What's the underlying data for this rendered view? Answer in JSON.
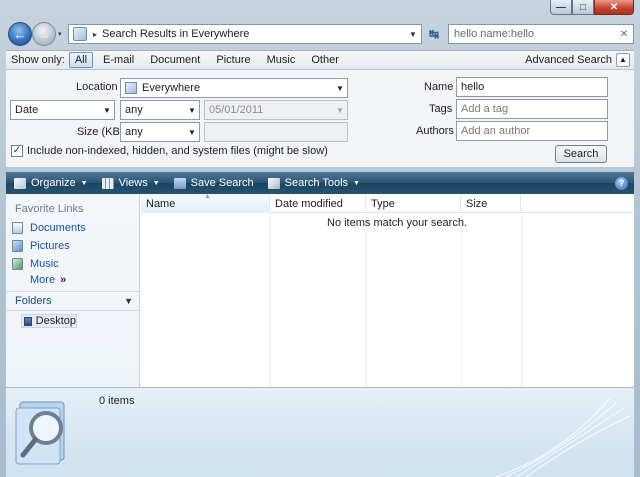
{
  "window": {
    "minimize_glyph": "—",
    "maximize_glyph": "□",
    "close_glyph": "✕"
  },
  "navigation": {
    "back_glyph": "←",
    "forward_glyph": "→",
    "history_glyph": "▾",
    "address": {
      "separator_glyph": "▸",
      "text": "Search Results in Everywhere",
      "dropdown_glyph": "▼"
    },
    "refresh_glyph": "↹",
    "search_value": "hello name:hello",
    "clear_glyph": "✕"
  },
  "show_only": {
    "label": "Show only:",
    "filters": [
      "All",
      "E-mail",
      "Document",
      "Picture",
      "Music",
      "Other"
    ],
    "active": "All",
    "advanced_label": "Advanced Search",
    "advanced_glyph": "▲"
  },
  "advanced": {
    "location_label": "Location",
    "location_value": "Everywhere",
    "date_field": "Date",
    "date_condition": "any",
    "date_value": "05/01/2011",
    "size_label": "Size (KB)",
    "size_condition": "any",
    "size_value": "",
    "include_label": "Include non-indexed, hidden, and system files (might be slow)",
    "include_checked_glyph": "✓",
    "name_label": "Name",
    "name_value": "hello",
    "tags_label": "Tags",
    "tags_placeholder": "Add a tag",
    "authors_label": "Authors",
    "authors_placeholder": "Add an author",
    "search_button": "Search",
    "dropdown_glyph": "▼"
  },
  "toolbar": {
    "organize": "Organize",
    "views": "Views",
    "save_search": "Save Search",
    "search_tools": "Search Tools",
    "dropdown_glyph": "▼",
    "help_glyph": "?"
  },
  "left_pane": {
    "favorite_links_title": "Favorite Links",
    "links": [
      "Documents",
      "Pictures",
      "Music"
    ],
    "more_label": "More",
    "more_glyph": "»",
    "folders_label": "Folders",
    "folders_glyph": "▼",
    "desktop_label": "Desktop"
  },
  "list": {
    "columns": [
      "Name",
      "Date modified",
      "Type",
      "Size"
    ],
    "sort_glyph": "▲",
    "empty_message": "No items match your search."
  },
  "details": {
    "item_count": "0 items"
  }
}
